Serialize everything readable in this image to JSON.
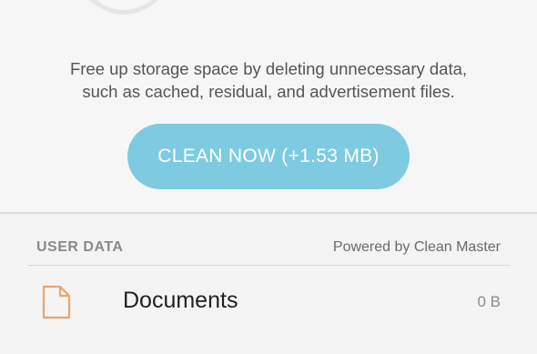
{
  "description": {
    "line1": "Free up storage space by deleting unnecessary data,",
    "line2": "such as cached, residual, and advertisement files."
  },
  "clean_button": {
    "label": "CLEAN NOW (+1.53 MB)"
  },
  "user_data_section": {
    "header": "USER DATA",
    "powered_by": "Powered by Clean Master",
    "items": [
      {
        "label": "Documents",
        "size": "0 B",
        "icon": "document-icon"
      }
    ]
  },
  "colors": {
    "accent": "#7ecbe1",
    "doc_icon": "#e8a56d",
    "background": "#f4f4f4"
  }
}
